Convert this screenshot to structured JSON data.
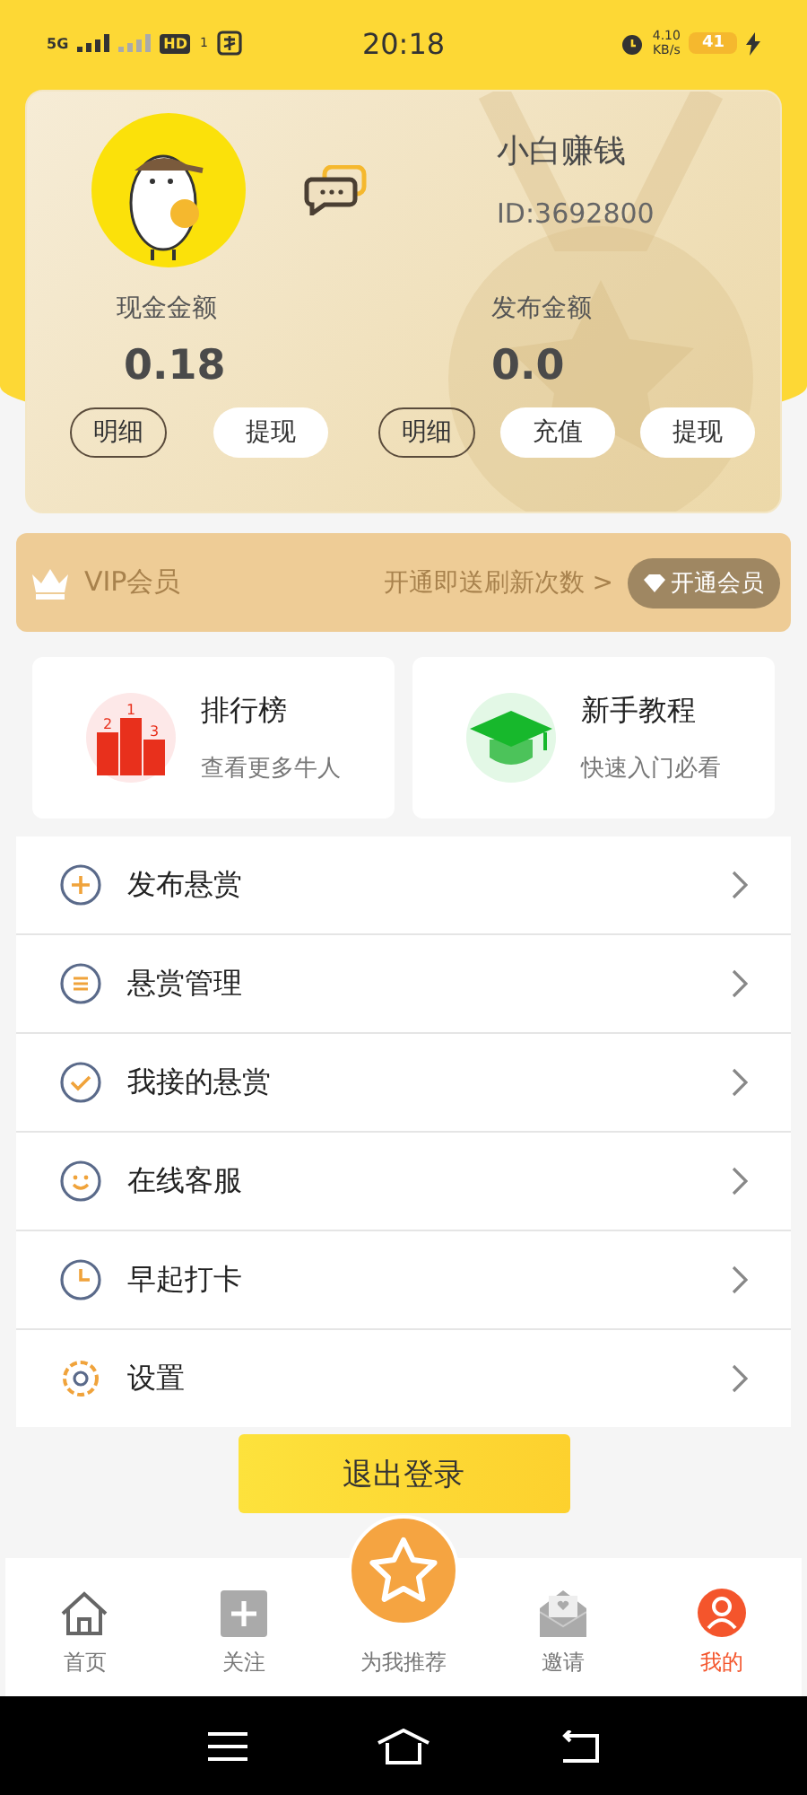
{
  "status_bar": {
    "network": "5G",
    "hd": "HD",
    "sim": "1",
    "time": "20:18",
    "speed": "4.10",
    "speed_unit": "KB/s",
    "battery": "41"
  },
  "profile": {
    "name": "小白赚钱",
    "id": "ID:3692800",
    "balances": [
      {
        "label": "现金金额",
        "amount": "0.18",
        "buttons": [
          {
            "label": "明细",
            "kind": "outline"
          },
          {
            "label": "提现",
            "kind": "filled"
          }
        ]
      },
      {
        "label": "发布金额",
        "amount": "0.0",
        "buttons": [
          {
            "label": "明细",
            "kind": "outline"
          },
          {
            "label": "充值",
            "kind": "filled"
          },
          {
            "label": "提现",
            "kind": "filled"
          }
        ]
      }
    ]
  },
  "vip": {
    "label": "VIP会员",
    "promo": "开通即送刷新次数 >",
    "button": "开通会员"
  },
  "shortcuts": [
    {
      "title": "排行榜",
      "subtitle": "查看更多牛人",
      "kind": "podium",
      "ranks": [
        "2",
        "1",
        "3"
      ]
    },
    {
      "title": "新手教程",
      "subtitle": "快速入门必看",
      "kind": "cap"
    }
  ],
  "menu": [
    {
      "label": "发布悬赏",
      "kind": "plus"
    },
    {
      "label": "悬赏管理",
      "kind": "list"
    },
    {
      "label": "我接的悬赏",
      "kind": "check"
    },
    {
      "label": "在线客服",
      "kind": "smile"
    },
    {
      "label": "早起打卡",
      "kind": "clock"
    },
    {
      "label": "设置",
      "kind": "gear"
    }
  ],
  "logout": "退出登录",
  "tab_bar": [
    {
      "label": "首页",
      "kind": "home",
      "selected": false
    },
    {
      "label": "关注",
      "kind": "plus",
      "selected": false
    },
    {
      "label": "为我推荐",
      "kind": "star",
      "selected": false
    },
    {
      "label": "邀请",
      "kind": "mail",
      "selected": false
    },
    {
      "label": "我的",
      "kind": "user",
      "selected": true
    }
  ]
}
